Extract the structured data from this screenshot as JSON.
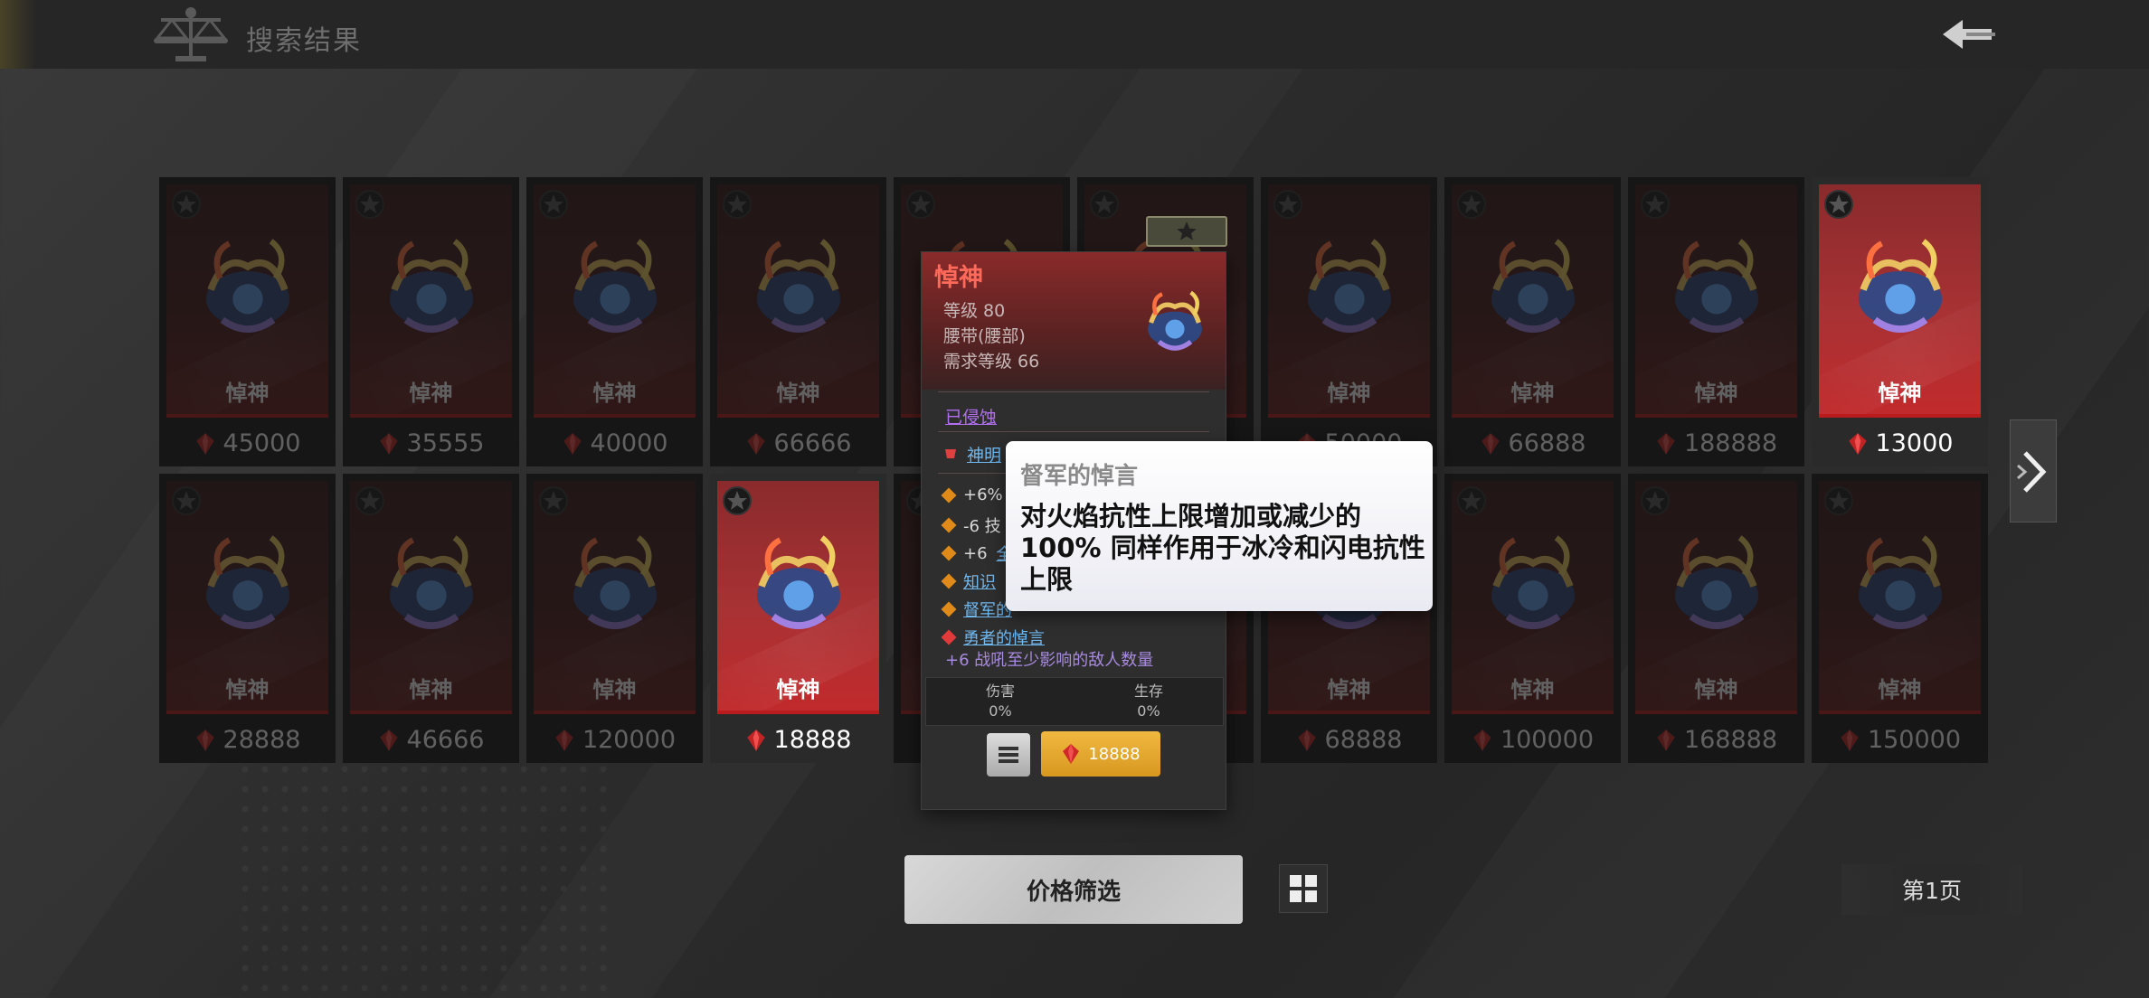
{
  "header": {
    "title": "搜索结果"
  },
  "cards_row1": [
    {
      "name": "悼神",
      "price": "45000",
      "selected": false
    },
    {
      "name": "悼神",
      "price": "35555",
      "selected": false
    },
    {
      "name": "悼神",
      "price": "40000",
      "selected": false
    },
    {
      "name": "悼神",
      "price": "66666",
      "selected": false
    },
    {
      "name": "",
      "price": "",
      "selected": false
    },
    {
      "name": "",
      "price": "",
      "selected": false
    },
    {
      "name": "悼神",
      "price": "50000",
      "selected": false
    },
    {
      "name": "悼神",
      "price": "66888",
      "selected": false
    },
    {
      "name": "悼神",
      "price": "188888",
      "selected": false
    },
    {
      "name": "悼神",
      "price": "13000",
      "selected": true
    }
  ],
  "cards_row2": [
    {
      "name": "悼神",
      "price": "28888",
      "selected": false
    },
    {
      "name": "悼神",
      "price": "46666",
      "selected": false
    },
    {
      "name": "悼神",
      "price": "120000",
      "selected": false
    },
    {
      "name": "悼神",
      "price": "18888",
      "selected": true
    },
    {
      "name": "",
      "price": "",
      "selected": false
    },
    {
      "name": "",
      "price": "",
      "selected": false
    },
    {
      "name": "悼神",
      "price": "68888",
      "selected": false
    },
    {
      "name": "悼神",
      "price": "100000",
      "selected": false
    },
    {
      "name": "悼神",
      "price": "168888",
      "selected": false
    },
    {
      "name": "悼神",
      "price": "150000",
      "selected": false
    }
  ],
  "tooltip": {
    "name": "悼神",
    "level": "等级 80",
    "slot": "腰带(腰部)",
    "required_level": "需求等级 66",
    "corrupted": "已侵蚀",
    "god_link": "神明",
    "mods": [
      {
        "text": "+6%",
        "link": "",
        "color": "orange"
      },
      {
        "text": "-6 技",
        "link": "",
        "color": "orange"
      },
      {
        "text": "+6",
        "link": "全",
        "color": "orange"
      },
      {
        "text": "",
        "link": "知识",
        "color": "orange"
      },
      {
        "text": "",
        "link": "督军的",
        "color": "orange"
      },
      {
        "text": "",
        "link": "勇者的悼言",
        "color": "red"
      }
    ],
    "mod_sub": "+6 战吼至少影响的敌人数量",
    "stat_damage_label": "伤害",
    "stat_damage_value": "0%",
    "stat_survival_label": "生存",
    "stat_survival_value": "0%",
    "buy_price": "18888"
  },
  "popup": {
    "title": "督军的悼言",
    "description": "对火焰抗性上限增加或减少的 100% 同样作用于冰冷和闪电抗性上限"
  },
  "footer": {
    "filter_label": "价格筛选",
    "page_label": "第1页"
  },
  "colors": {
    "accent_red": "#c22a2c",
    "gold": "#e8a830",
    "link_blue": "#70b8f0",
    "corrupt_purple": "#b070f0"
  }
}
